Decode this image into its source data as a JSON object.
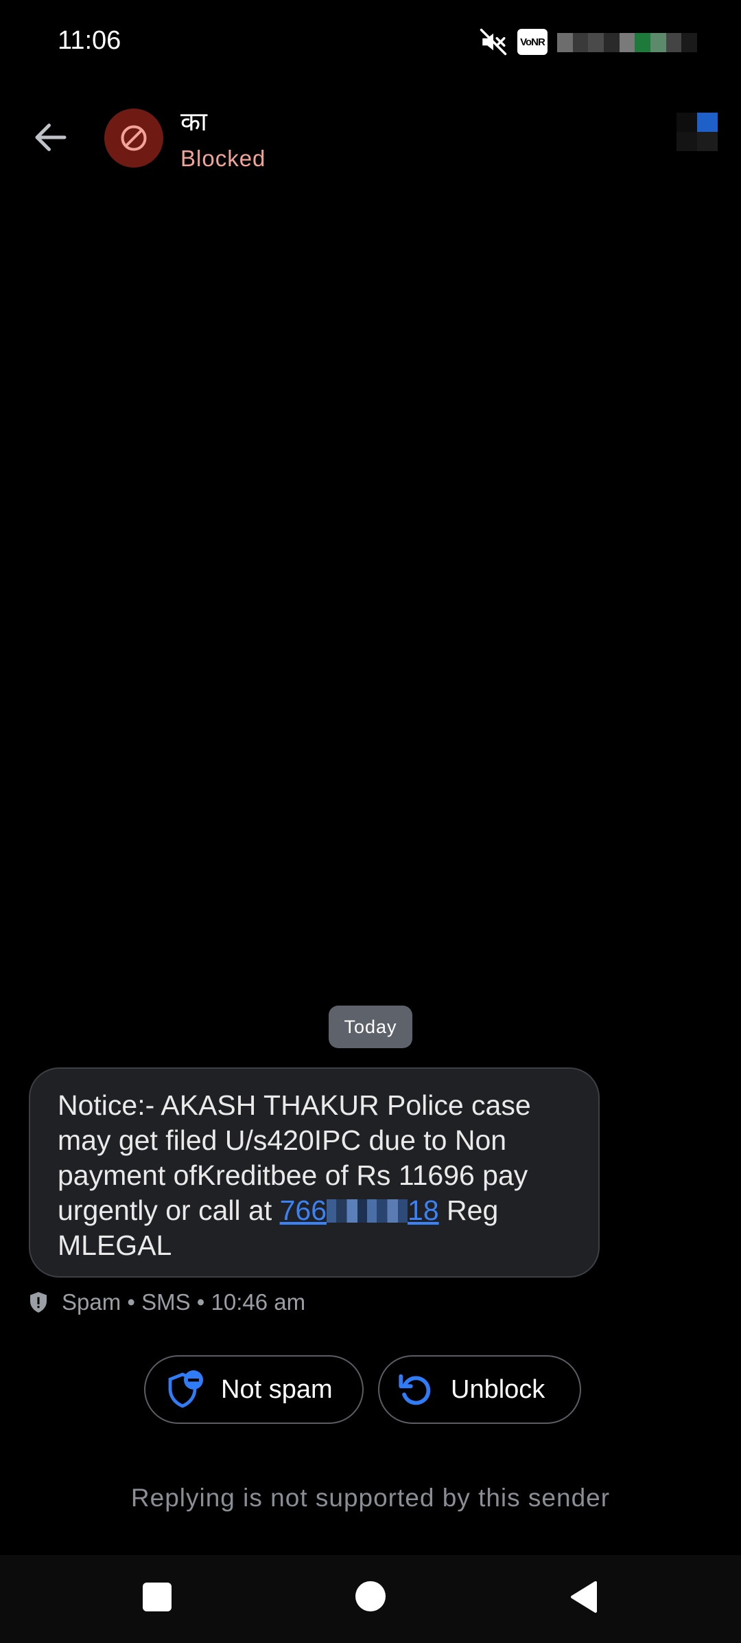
{
  "status_bar": {
    "time": "11:06",
    "vonr_label": "VoNR",
    "icons": [
      "mute-icon",
      "vonr-badge"
    ]
  },
  "header": {
    "contact_name": "का",
    "contact_status": "Blocked",
    "avatar_icon": "blocked-icon",
    "back_icon": "back-arrow-icon"
  },
  "conversation": {
    "date_label": "Today",
    "message": {
      "text_before_link": "Notice:- AKASH THAKUR Police case may get filed U/s420IPC due to Non payment ofKreditbee of Rs 11696 pay urgently or call at ",
      "link_prefix": "766",
      "link_suffix": "18",
      "text_after_link": " Reg MLEGAL"
    },
    "meta": "Spam • SMS • 10:46 am"
  },
  "actions": {
    "not_spam_label": "Not spam",
    "unblock_label": "Unblock"
  },
  "footer": {
    "reply_note": "Replying is not supported by this sender"
  },
  "colors": {
    "background": "#000000",
    "bubble": "#202124",
    "avatar_bg": "#6f1b14",
    "blocked_text": "#f3a49a",
    "link": "#3b82f6",
    "accent_icon": "#2f7cf6",
    "muted_text": "#9a9ea5"
  }
}
